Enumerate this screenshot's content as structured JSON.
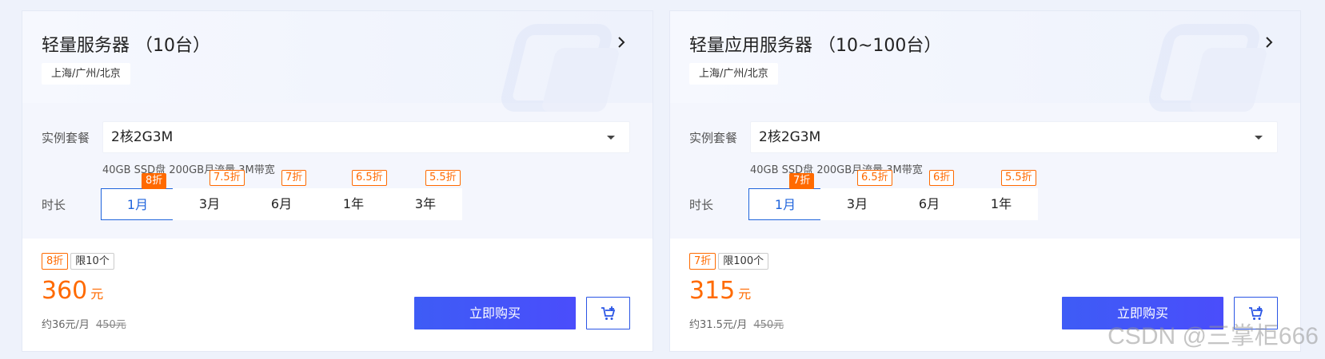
{
  "cards": [
    {
      "title": "轻量服务器 （10台）",
      "region": "上海/广州/北京",
      "plan_label": "实例套餐",
      "plan_value": "2核2G3M",
      "spec": "40GB SSD盘 200GB月流量 3M带宽",
      "duration_label": "时长",
      "durations": [
        {
          "label": "1月",
          "discount": "8折",
          "active": true
        },
        {
          "label": "3月",
          "discount": "7.5折",
          "active": false
        },
        {
          "label": "6月",
          "discount": "7折",
          "active": false
        },
        {
          "label": "1年",
          "discount": "6.5折",
          "active": false
        },
        {
          "label": "3年",
          "discount": "5.5折",
          "active": false
        }
      ],
      "tag_discount": "8折",
      "tag_limit": "限10个",
      "price": "360",
      "price_unit": "元",
      "approx": "约36元/月",
      "old_price": "450元",
      "buy_label": "立即购买"
    },
    {
      "title": "轻量应用服务器 （10~100台）",
      "region": "上海/广州/北京",
      "plan_label": "实例套餐",
      "plan_value": "2核2G3M",
      "spec": "40GB SSD盘 200GB月流量 3M带宽",
      "duration_label": "时长",
      "durations": [
        {
          "label": "1月",
          "discount": "7折",
          "active": true
        },
        {
          "label": "3月",
          "discount": "6.5折",
          "active": false
        },
        {
          "label": "6月",
          "discount": "6折",
          "active": false
        },
        {
          "label": "1年",
          "discount": "5.5折",
          "active": false
        }
      ],
      "tag_discount": "7折",
      "tag_limit": "限100个",
      "price": "315",
      "price_unit": "元",
      "approx": "约31.5元/月",
      "old_price": "450元",
      "buy_label": "立即购买"
    }
  ],
  "colors": {
    "accent": "#ff6a00",
    "primary": "#3e5cf6",
    "selected": "#1f64dc"
  },
  "icons": {
    "arrow": "chevron-right-icon",
    "dropdown": "caret-down-icon",
    "cart": "cart-add-icon"
  },
  "watermark": "CSDN @三掌柜666"
}
